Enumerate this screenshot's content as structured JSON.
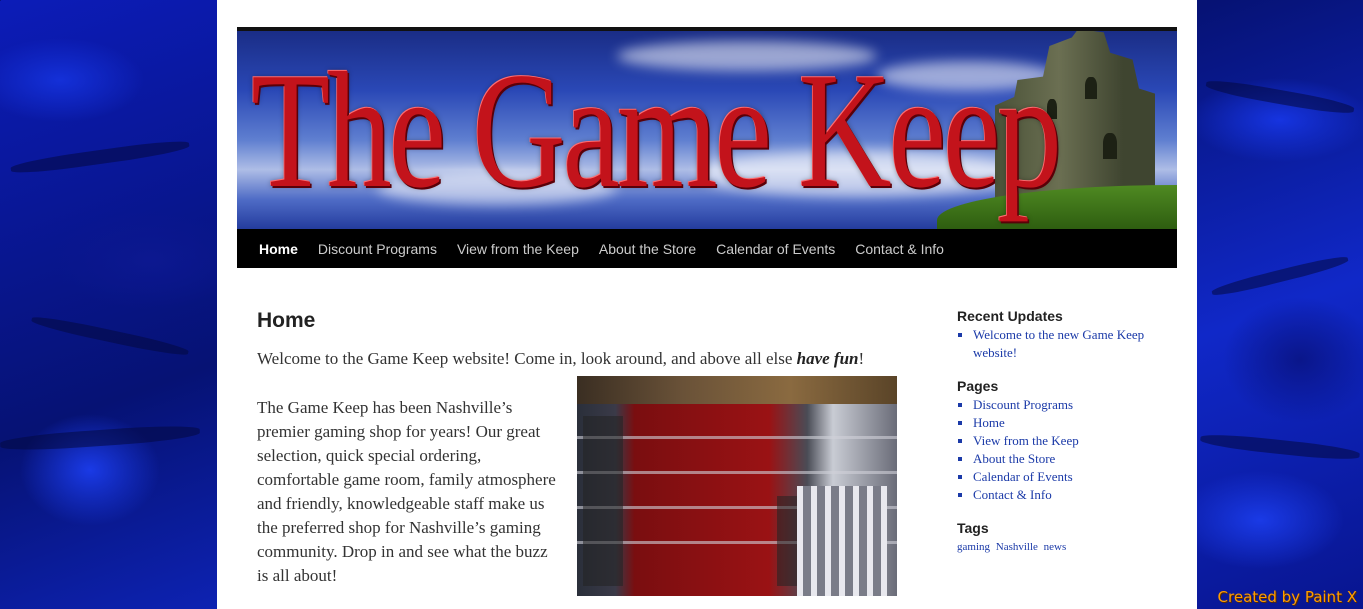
{
  "site": {
    "title": "The Game Keep"
  },
  "nav": {
    "items": [
      {
        "label": "Home",
        "active": true
      },
      {
        "label": "Discount Programs",
        "active": false
      },
      {
        "label": "View from the Keep",
        "active": false
      },
      {
        "label": "About the Store",
        "active": false
      },
      {
        "label": "Calendar of Events",
        "active": false
      },
      {
        "label": "Contact & Info",
        "active": false
      }
    ]
  },
  "main": {
    "page_title": "Home",
    "welcome_text": "Welcome to the Game Keep website!  Come in, look around, and above all else ",
    "welcome_emphasis": "have fun",
    "welcome_end": "!",
    "about_text": "The Game Keep has been Nashville’s premier gaming shop for years! Our great selection, quick special ordering, comfortable game room, family atmosphere and friendly, knowledgeable staff make us the preferred shop for Nashville’s gaming community.  Drop in and see what the buzz is all about!"
  },
  "sidebar": {
    "recent_updates": {
      "title": "Recent Updates",
      "items": [
        "Welcome to the new Game Keep website!"
      ]
    },
    "pages": {
      "title": "Pages",
      "items": [
        "Discount Programs",
        "Home",
        "View from the Keep",
        "About the Store",
        "Calendar of Events",
        "Contact & Info"
      ]
    },
    "tags": {
      "title": "Tags",
      "items": [
        "gaming",
        "Nashville",
        "news"
      ]
    }
  },
  "footer": {
    "credit": "Created by Paint X"
  },
  "colors": {
    "title_red": "#c3131b",
    "link_blue": "#1b3aa8",
    "credit_orange": "#ff9d00",
    "nav_bg": "#000000"
  }
}
